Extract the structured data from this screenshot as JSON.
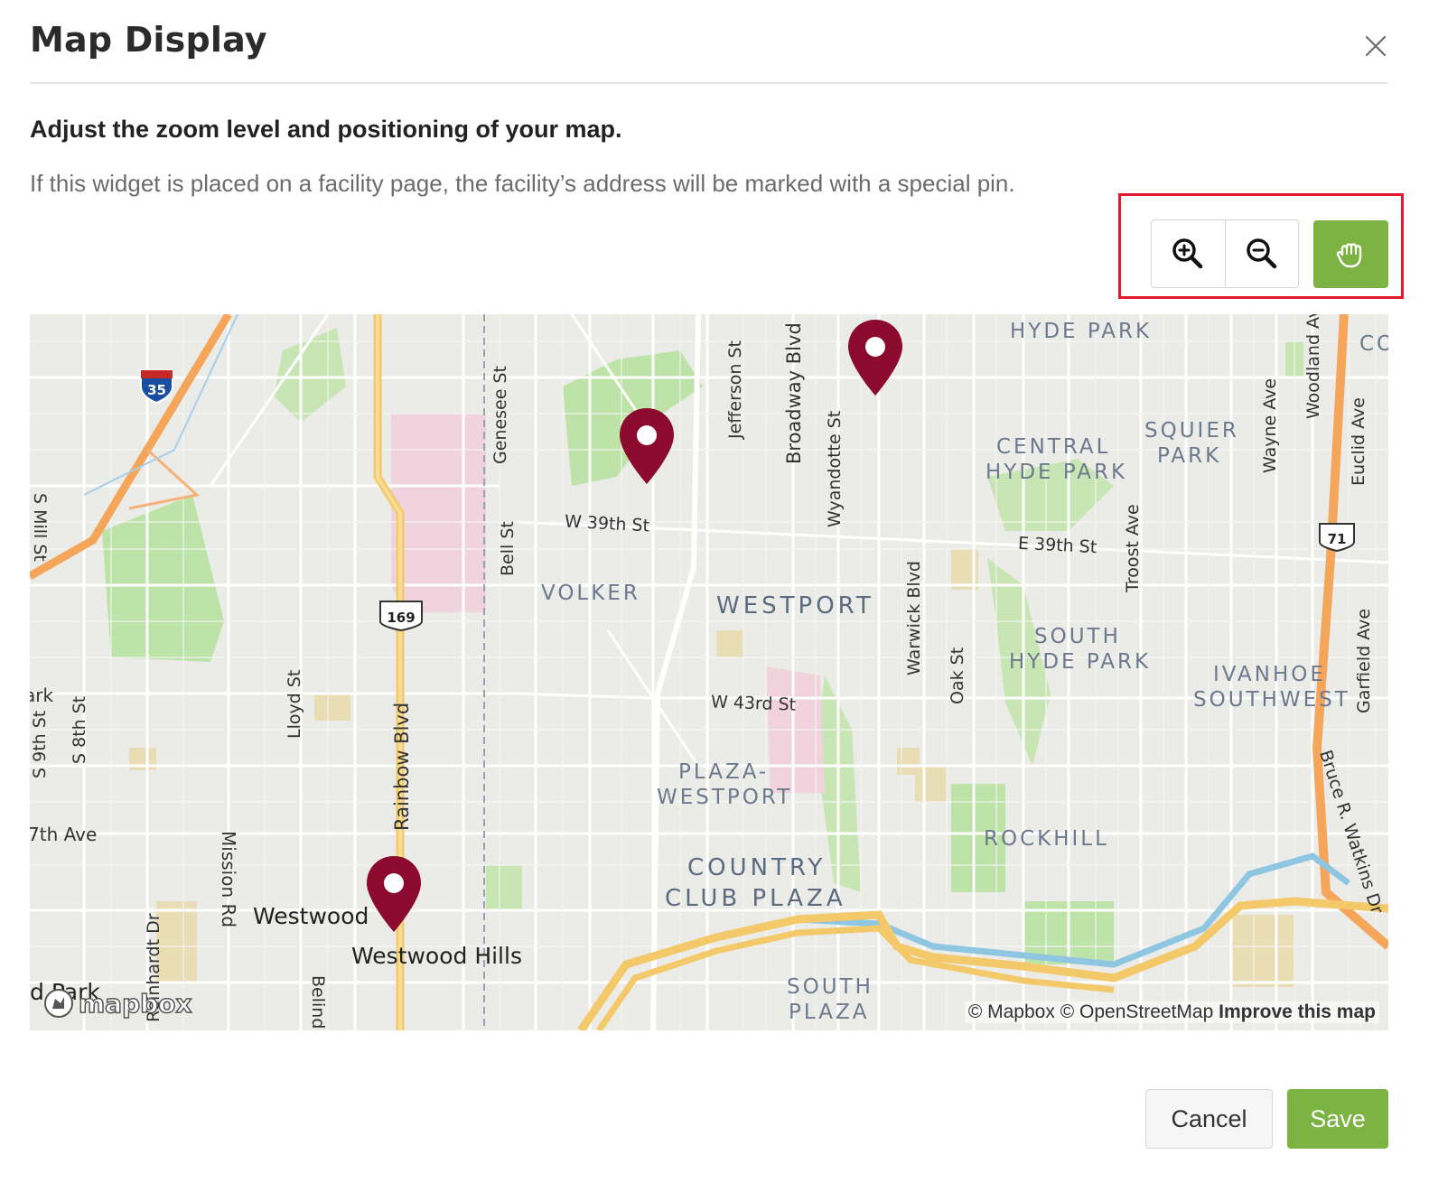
{
  "modal": {
    "title": "Map Display",
    "heading": "Adjust the zoom level and positioning of your map.",
    "description": "If this widget is placed on a facility page, the facility’s address will be marked with a special pin."
  },
  "controls": {
    "zoom_in_icon": "zoom-in-icon",
    "zoom_out_icon": "zoom-out-icon",
    "pan_icon": "hand-icon",
    "active_color": "#7cb342",
    "highlight_color": "#e4182d"
  },
  "map": {
    "pin_color": "#8b0a2e",
    "neighborhoods": [
      "HYDE PARK",
      "CENTRAL",
      "HYDE PARK",
      "SQUIER",
      "PARK",
      "VOLKER",
      "WESTPORT",
      "SOUTH",
      "HYDE PARK",
      "IVANHOE",
      "SOUTHWEST",
      "PLAZA-",
      "WESTPORT",
      "ROCKHILL",
      "COUNTRY",
      "CLUB PLAZA",
      "SOUTH",
      "PLAZA",
      "CO"
    ],
    "streets": [
      "W 39th St",
      "E 39th St",
      "W 43rd St",
      "Genesee St",
      "Jefferson St",
      "Broadway Blvd",
      "Wyandotte St",
      "Bell St",
      "Warwick Blvd",
      "Oak St",
      "Troost Ave",
      "Wayne Ave",
      "Woodland Av",
      "Euclid Ave",
      "Garfield Ave",
      "Bruce R. Watkins Dr",
      "S Mill St",
      "Lloyd St",
      "S 8th St",
      "S 9th St",
      "Rainbow Blvd",
      "Mission Rd",
      "Reinhardt Dr",
      "Belind",
      "7th Ave",
      "ark"
    ],
    "places": [
      "Westwood",
      "Westwood Hills",
      "d Park"
    ],
    "shields": [
      "35",
      "169",
      "71"
    ],
    "attribution": {
      "mapbox": "© Mapbox",
      "osm": "© OpenStreetMap",
      "improve": "Improve this map"
    },
    "logo_text": "mapbox"
  },
  "footer": {
    "cancel_label": "Cancel",
    "save_label": "Save"
  }
}
